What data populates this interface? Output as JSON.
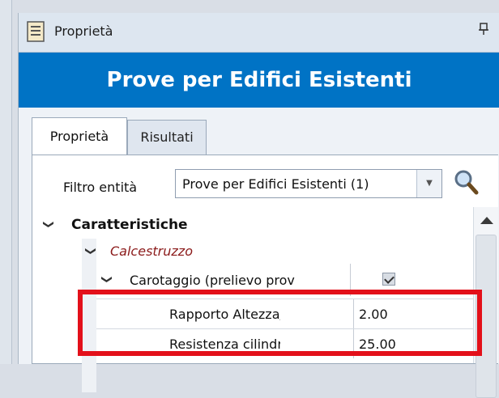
{
  "panel": {
    "title": "Proprietà",
    "icons": {
      "doc": "document-icon",
      "pin": "pin-icon"
    },
    "banner": "Prove per Edifici Esistenti"
  },
  "tabs": [
    {
      "label": "Proprietà",
      "active": true
    },
    {
      "label": "Risultati",
      "active": false
    }
  ],
  "filter": {
    "label": "Filtro entità",
    "value": "Prove per Edifici Esistenti (1)",
    "search_icon": "search-icon"
  },
  "grid": {
    "category": "Caratteristiche",
    "subcategory": "Calcestruzzo",
    "property": {
      "label": "Carotaggio (prelievo prov",
      "checked": true
    },
    "rows": [
      {
        "label": "Rapporto Altezza/Dia",
        "value": "2.00"
      },
      {
        "label": "Resistenza cilindrica a",
        "value": "25.00"
      }
    ]
  },
  "colors": {
    "banner": "#0073c5",
    "highlight": "#e3101a",
    "subcategory_text": "#8b1a1a"
  }
}
